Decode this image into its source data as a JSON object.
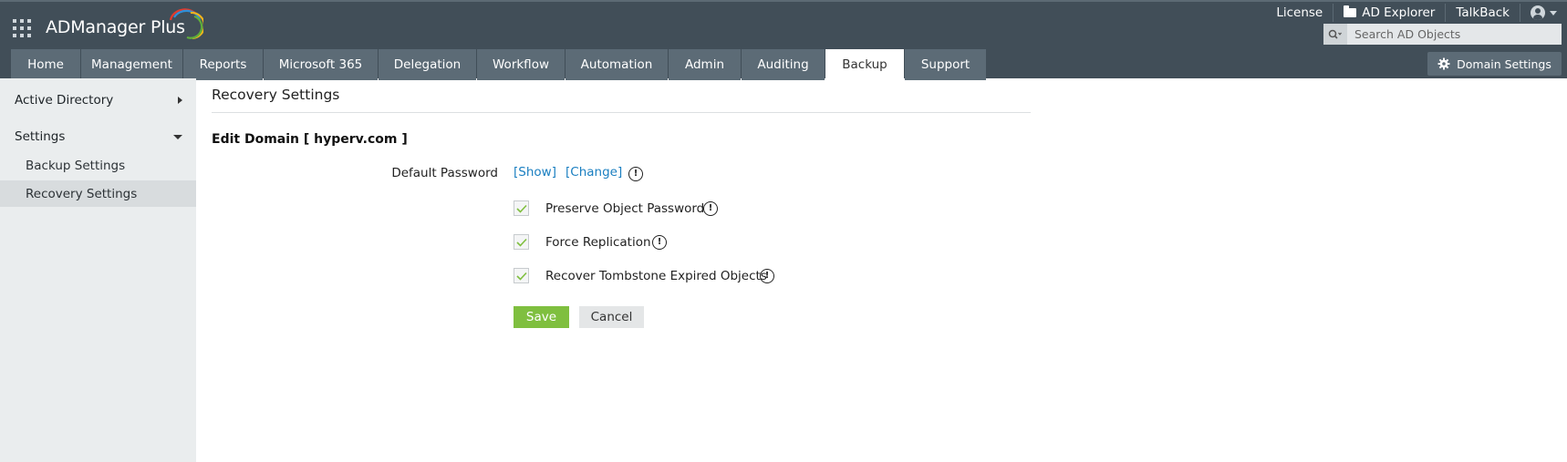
{
  "header": {
    "app_name": "ADManager Plus",
    "top_links": {
      "license": "License",
      "ad_explorer": "AD Explorer",
      "talkback": "TalkBack"
    },
    "search": {
      "placeholder": "Search AD Objects"
    },
    "domain_settings_label": "Domain Settings",
    "colors": {
      "header_bg": "#414e58",
      "tab_bg": "#5c6b76",
      "tab_active_bg": "#ffffff"
    }
  },
  "tabs": [
    {
      "label": "Home"
    },
    {
      "label": "Management"
    },
    {
      "label": "Reports"
    },
    {
      "label": "Microsoft 365"
    },
    {
      "label": "Delegation"
    },
    {
      "label": "Workflow"
    },
    {
      "label": "Automation"
    },
    {
      "label": "Admin"
    },
    {
      "label": "Auditing"
    },
    {
      "label": "Backup",
      "active": true
    },
    {
      "label": "Support"
    }
  ],
  "sidebar": {
    "sections": [
      {
        "label": "Active Directory",
        "expanded": false
      },
      {
        "label": "Settings",
        "expanded": true
      }
    ],
    "items": [
      {
        "label": "Backup Settings"
      },
      {
        "label": "Recovery Settings",
        "active": true
      }
    ]
  },
  "main": {
    "title": "Recovery Settings",
    "edit_domain": "Edit Domain [ hyperv.com ]",
    "default_password_label": "Default Password",
    "show_link": "[Show]",
    "change_link": "[Change]",
    "options": [
      {
        "label": "Preserve Object Password",
        "checked": true
      },
      {
        "label": "Force Replication",
        "checked": true
      },
      {
        "label": "Recover Tombstone Expired Objects",
        "checked": true
      }
    ],
    "save_label": "Save",
    "cancel_label": "Cancel",
    "colors": {
      "link": "#1a7fc1",
      "save_bg": "#7fbf3f",
      "check": "#7fbf3f"
    }
  },
  "icons": {
    "app_grid": "app-grid-icon",
    "folder": "folder-icon",
    "user": "user-icon",
    "search": "search-icon",
    "gear": "gear-icon",
    "info": "info-icon",
    "check": "check-icon"
  }
}
